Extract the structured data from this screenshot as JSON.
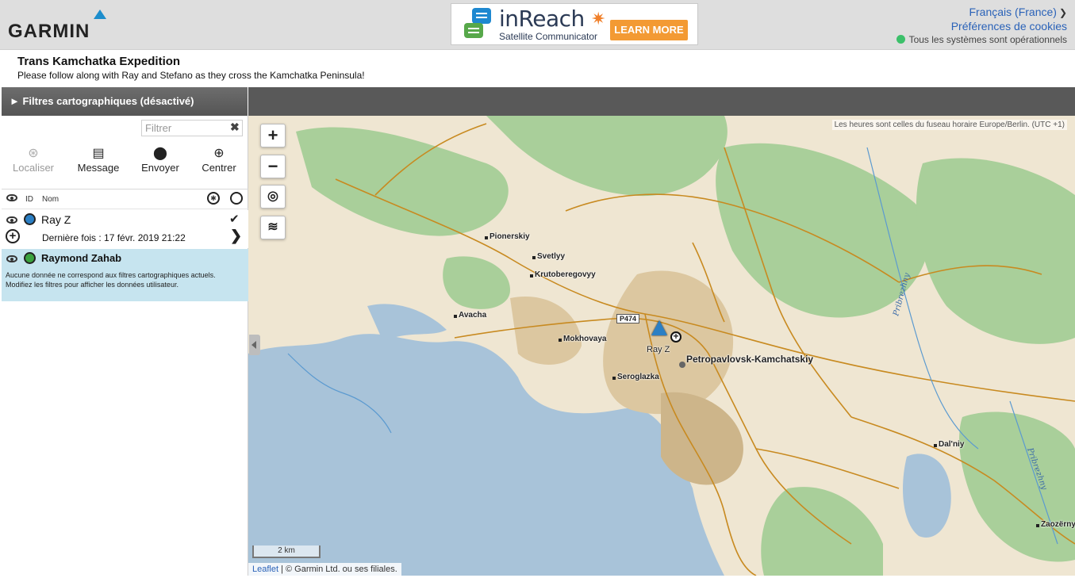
{
  "header": {
    "logo_text": "GARMIN",
    "ad": {
      "title": "inReach",
      "subtitle": "Satellite Communicator",
      "button": "LEARN MORE"
    },
    "language": "Français (France)",
    "cookies": "Préférences de cookies",
    "status": "Tous les systèmes sont opérationnels"
  },
  "page": {
    "title": "Trans Kamchatka Expedition",
    "subtitle": "Please follow along with Ray and Stefano as they cross the Kamchatka Peninsula!"
  },
  "panel": {
    "filters_title": "► Filtres cartographiques (désactivé)",
    "filter_placeholder": "Filtrer",
    "actions": {
      "locate": "Localiser",
      "message": "Message",
      "send": "Envoyer",
      "center": "Centrer"
    },
    "list_header": {
      "id": "ID",
      "name": "Nom"
    },
    "users": [
      {
        "name": "Ray Z",
        "last_seen": "Dernière fois : 17 févr. 2019 21:22",
        "color": "#2b7fc4"
      },
      {
        "name": "Raymond Zahab",
        "note": "Aucune donnée ne correspond aux filtres cartographiques actuels. Modifiez les filtres pour afficher les données utilisateur.",
        "color": "#3ba33e"
      }
    ]
  },
  "map": {
    "zoom_in": "+",
    "zoom_out": "−",
    "timezone_note": "Les heures sont celles du fuseau horaire Europe/Berlin. (UTC +1)",
    "places": [
      "Pionerskiy",
      "Svetlyy",
      "Krutoberegovyy",
      "Avacha",
      "Mokhovaya",
      "Seroglazka",
      "Dal'niy",
      "Zaozërny"
    ],
    "city": "Petropavlovsk-Kamchatskiy",
    "road": "P474",
    "rivers": [
      "Pribrezhny",
      "Pribrezhny"
    ],
    "marker_label": "Ray Z",
    "scale": "2 km",
    "attribution_link": "Leaflet",
    "attribution_text": " | © Garmin Ltd. ou ses filiales."
  }
}
